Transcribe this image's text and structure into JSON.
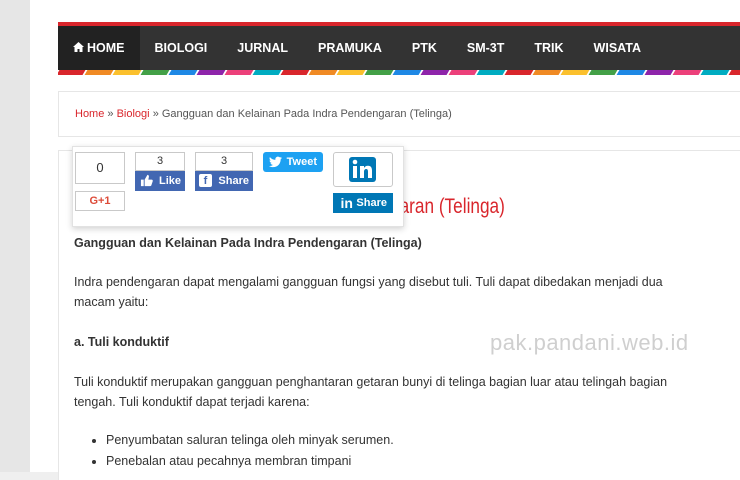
{
  "nav": {
    "items": [
      {
        "label": "HOME",
        "active": true
      },
      {
        "label": "BIOLOGI"
      },
      {
        "label": "JURNAL"
      },
      {
        "label": "PRAMUKA"
      },
      {
        "label": "PTK"
      },
      {
        "label": "SM-3T"
      },
      {
        "label": "TRIK"
      },
      {
        "label": "WISATA"
      }
    ],
    "home_icon": "home-icon",
    "accent_color": "#d9262c",
    "stripe_colors": [
      "#d9262c",
      "#f08a24",
      "#fbc02d",
      "#43a047",
      "#1e88e5",
      "#8e24aa",
      "#ec407a",
      "#00acc1"
    ]
  },
  "breadcrumb": {
    "home": "Home",
    "separator": "»",
    "category": "Biologi",
    "current": "Gangguan dan Kelainan Pada Indra Pendengaran (Telinga)"
  },
  "share": {
    "gplus_count": "0",
    "gplus_label": "G+1",
    "fb_like_count": "3",
    "fb_like_label": "Like",
    "fb_share_count": "3",
    "fb_share_label": "Share",
    "tweet_label": "Tweet",
    "linkedin_label": "Share"
  },
  "article": {
    "title_visible": "garan (Telinga)",
    "heading": "Gangguan dan Kelainan Pada Indra Pendengaran (Telinga)",
    "intro": "Indra pendengaran dapat mengalami gangguan fungsi yang disebut tuli. Tuli dapat dibedakan menjadi dua macam yaitu:",
    "section_a": "a. Tuli konduktif",
    "section_a_text": "Tuli konduktif merupakan gangguan penghantaran getaran bunyi di telinga bagian luar atau telingah bagian tengah. Tuli konduktif dapat terjadi karena:",
    "causes": [
      "Penyumbatan saluran telinga oleh minyak serumen.",
      "Penebalan atau pecahnya membran timpani"
    ]
  },
  "watermark": "pak.pandani.web.id"
}
